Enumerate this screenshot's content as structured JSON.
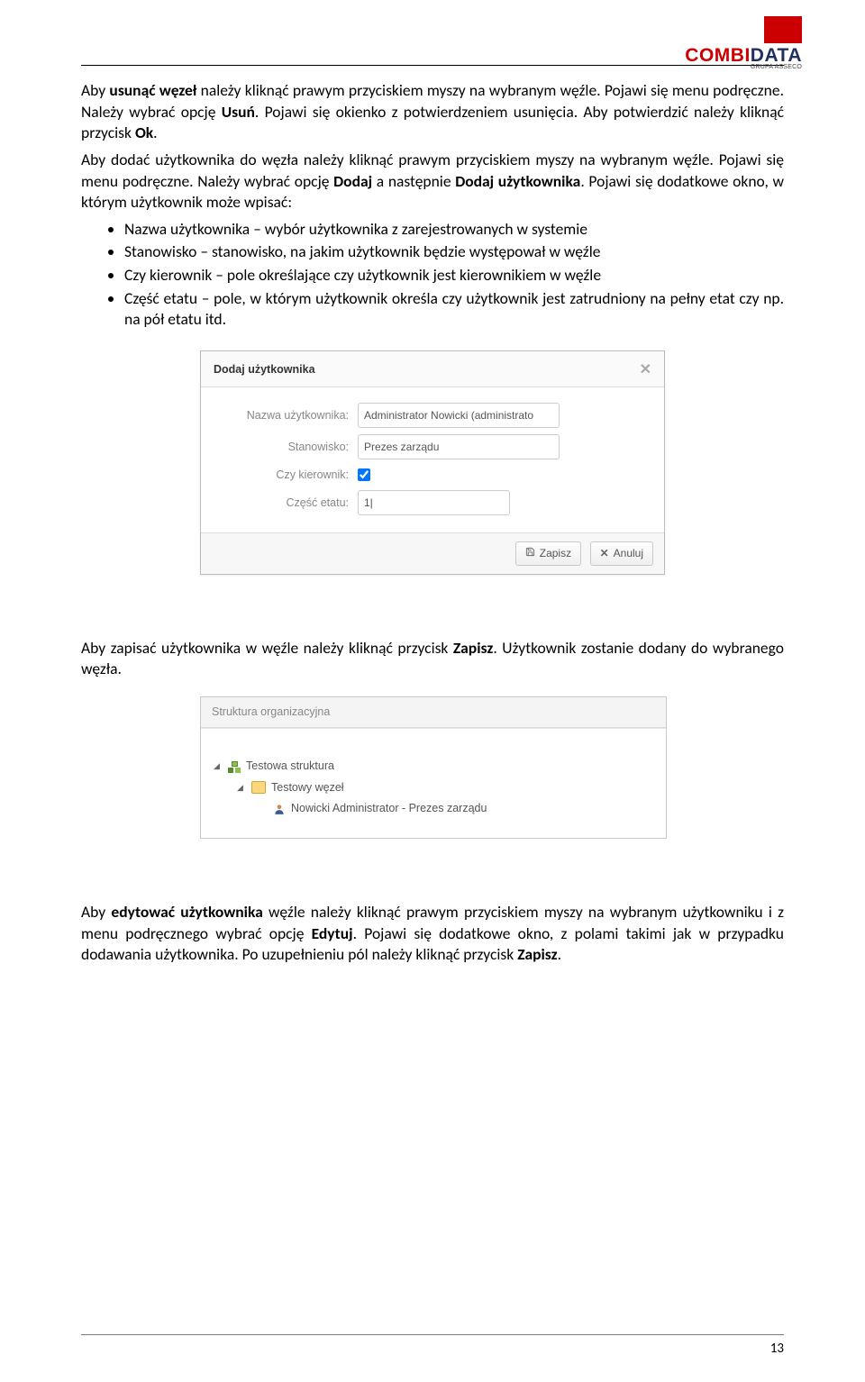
{
  "logo": {
    "line1a": "COMBI",
    "line1b": "DATA",
    "line2": "GRUPA ASSECO"
  },
  "para": {
    "p1a": "Aby ",
    "p1b": "usunąć węzeł",
    "p1c": " należy kliknąć prawym przyciskiem myszy na wybranym węźle. Pojawi się menu podręczne. Należy wybrać opcję ",
    "p1d": "Usuń",
    "p1e": ". Pojawi się okienko z potwierdzeniem usunięcia. Aby potwierdzić należy kliknąć przycisk ",
    "p1f": "Ok",
    "p1g": ".",
    "p2a": "Aby dodać użytkownika do węzła należy kliknąć prawym przyciskiem myszy na wybranym węźle. Pojawi się menu podręczne. Należy wybrać opcję ",
    "p2b": "Dodaj",
    "p2c": " a następnie ",
    "p2d": "Dodaj użytkownika",
    "p2e": ". Pojawi się dodatkowe okno, w którym użytkownik może wpisać:",
    "p3a": "Aby zapisać użytkownika w węźle należy kliknąć przycisk ",
    "p3b": "Zapisz",
    "p3c": ". Użytkownik zostanie dodany do wybranego węzła.",
    "p4a": "Aby ",
    "p4b": "edytować użytkownika",
    "p4c": " węźle należy kliknąć prawym przyciskiem myszy na wybranym użytkowniku i z menu podręcznego wybrać opcję ",
    "p4d": "Edytuj",
    "p4e": ". Pojawi się dodatkowe okno, z polami takimi jak w przypadku dodawania użytkownika. Po uzupełnieniu pól należy kliknąć przycisk ",
    "p4f": "Zapisz",
    "p4g": "."
  },
  "bullets": {
    "b1": "Nazwa użytkownika – wybór użytkownika z zarejestrowanych w systemie",
    "b2": "Stanowisko – stanowisko, na jakim użytkownik będzie występował w węźle",
    "b3": "Czy kierownik – pole określające czy użytkownik jest kierownikiem w węźle",
    "b4": "Część etatu – pole, w którym użytkownik określa czy użytkownik jest zatrudniony na pełny etat czy np. na pół etatu itd."
  },
  "modal": {
    "title": "Dodaj użytkownika",
    "labels": {
      "name": "Nazwa użytkownika:",
      "pos": "Stanowisko:",
      "mgr": "Czy kierownik:",
      "fte": "Część etatu:"
    },
    "values": {
      "name": "Administrator Nowicki (administrato",
      "pos": "Prezes zarządu",
      "fte": "1|"
    },
    "buttons": {
      "save": "Zapisz",
      "cancel": "Anuluj"
    }
  },
  "tree": {
    "title": "Struktura organizacyjna",
    "n1": "Testowa struktura",
    "n2": "Testowy węzeł",
    "n3": "Nowicki Administrator - Prezes zarządu"
  },
  "page_number": "13"
}
